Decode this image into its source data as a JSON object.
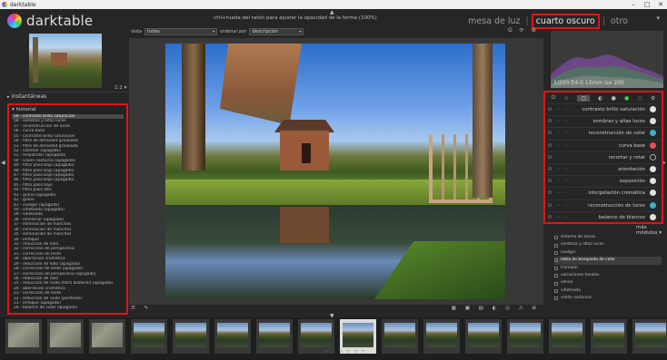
{
  "window": {
    "title": "darktable",
    "controls": [
      "–",
      "□",
      "✕"
    ]
  },
  "app": {
    "name": "darktable"
  },
  "header": {
    "hint": "ctrl+rueda del ratón para ajustar la opacidad de la forma (100%)",
    "views": [
      "mesa de luz",
      "cuarto oscuro",
      "otro"
    ],
    "active_view": "cuarto oscuro"
  },
  "left": {
    "snapshots_label": "instantáneas",
    "history_label": "historial",
    "history": [
      "59 - contraste brillo saturación",
      "58 - sombras y altas luces",
      "57 - reconstrucción de luces",
      "56 - curva base",
      "55 - contraste brillo saturación",
      "54 - filtro de densidad graduada",
      "53 - filtro de densidad graduada",
      "52 - colorear (apagado)",
      "51 - resplandor (apagado)",
      "50 - visión nocturna (apagado)",
      "49 - filtro paso bajo (apagado)",
      "48 - filtro paso bajo (apagado)",
      "47 - filtro paso bajo (apagado)",
      "46 - filtro paso bajo (apagado)",
      "45 - filtro paso bajo",
      "44 - filtro paso alto",
      "43 - grano (apagado)",
      "42 - grano",
      "41 - cuelgar (apagado)",
      "40 - viñeteado (apagado)",
      "39 - viñeteado",
      "38 - enmarcar (apagado)",
      "37 - eliminación de manchas",
      "36 - eliminación de manchas",
      "35 - eliminación de manchas",
      "34 - enfoque",
      "33 - reducción de halo",
      "32 - corrección de perspectiva",
      "31 - corrección de lente",
      "30 - aberración cromática",
      "29 - reducción de halo (apagado)",
      "28 - corrección de lente (apagado)",
      "27 - corrección de perspectiva (apagado)",
      "26 - reducción de halo",
      "25 - reducción de ruido (filtro bilateral) (apagado)",
      "24 - aberración cromática",
      "23 - corrección de lente",
      "22 - reducción de ruido (perfilado)",
      "21 - enfoque (apagado)",
      "20 - balance de color (apagado)"
    ],
    "nav_zoom": "1:1 ▾"
  },
  "toolbar": {
    "view_label": "vista",
    "view_value": "todas",
    "sort_label": "ordenar por",
    "sort_value": "descripción",
    "icons": "G ⟳ ⚙"
  },
  "right": {
    "exif": "1/200 f/4.0 12mm iso 200",
    "modules": [
      {
        "name": "contraste brillo saturación",
        "color": "#e0e0e0"
      },
      {
        "name": "sombras y altas luces",
        "color": "#e0e0e0"
      },
      {
        "name": "reconstrucción de color",
        "color": "#3ab0d0"
      },
      {
        "name": "curva base",
        "color": "#e05050"
      },
      {
        "name": "recortar y rotar",
        "color": "#222222"
      },
      {
        "name": "orientación",
        "color": "#e0e0e0"
      },
      {
        "name": "exposición",
        "color": "#e0e0e0"
      },
      {
        "name": "interpolación cromática",
        "color": "#e0e0e0"
      },
      {
        "name": "reconstrucción de luces",
        "color": "#3ab0d0"
      },
      {
        "name": "balance de blancos",
        "color": "#e0e0e0"
      }
    ],
    "more_label": "más módulos ▾",
    "more_modules": [
      "sistema de zonas",
      "sombras y altas luces",
      "cuelgar",
      "tabla de búsqueda de color",
      "tramado",
      "variaciones tonales",
      "velvia",
      "viñeteado",
      "visión nocturna"
    ],
    "more_highlight_index": 3
  },
  "filmstrip": {
    "rating": "✕ ☆ ☆ ☆ ☆ ☆"
  }
}
